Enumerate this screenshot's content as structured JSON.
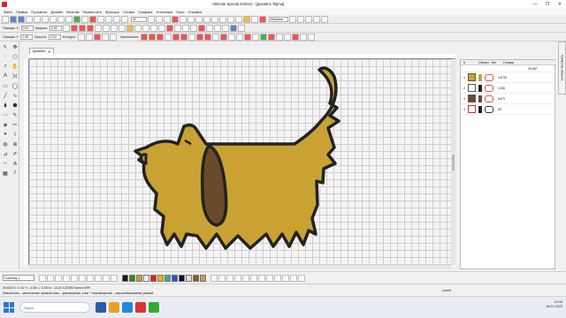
{
  "window": {
    "title": "Ultimate Special Edition) - [Дизайн1     Tajima]",
    "controls": [
      "—",
      "❐",
      "✕"
    ]
  },
  "menu": [
    "Файл",
    "Правка",
    "Просмотр",
    "Дизайн",
    "Монтаж",
    "Разместить",
    "Функции",
    "Стежки",
    "Графика",
    "Установки",
    "Окно",
    "Справка"
  ],
  "toolbar": {
    "zoom_value": "32",
    "metric": "Метрика"
  },
  "props": {
    "pos_x_label": "Позиция X:",
    "pos_x_value": "0.00",
    "pos_y_label": "Позиция Y:",
    "pos_y_value": "0.00",
    "width_label": "Ширина:",
    "width_value": "0.00",
    "height_label": "Высота:",
    "height_value": "0.00",
    "outline_label": "Контуры:",
    "fill_label": "Заполнение:"
  },
  "document": {
    "tab_label": "Дизайн1",
    "tab_close": "✕"
  },
  "objects_panel": {
    "headers": [
      "#",
      "",
      "Объект",
      "Тип",
      "Стежки"
    ],
    "top_count": "20.687",
    "rows": [
      {
        "num": "1",
        "count": "12743"
      },
      {
        "num": "2",
        "count": "1338"
      },
      {
        "num": "3",
        "count": "6473"
      },
      {
        "num": "4",
        "count": "83"
      }
    ]
  },
  "side_tab": "Свойства объекта",
  "bottom": {
    "color_select": "Colorway 1"
  },
  "palette": [
    "#1a1a1a",
    "#2a8a2a",
    "#c8a232",
    "#ffffff",
    "#d22",
    "#f4b400",
    "#4a8",
    "#2a4fd6",
    "#111",
    "#e3e3e3",
    "#8b5a2b",
    "#c96"
  ],
  "status": {
    "line1": "20.528           X= 0.44 Y= -0.08 L= 0.00 A= -13.20           CATEM Kamm 60%",
    "line2": "Левый клик – увеличение, правый клик – уменьшение; клик + перемещение – масштабирование рамкой",
    "right": "Level1"
  },
  "taskbar": {
    "search_placeholder": "Поиск",
    "time": "12:30",
    "date": "18.01.2023",
    "lang": "РУС"
  },
  "colors": {
    "fill": "#c9a233",
    "ear": "#6b4a2a",
    "outline": "#222222",
    "grid": "#cfcfcf"
  }
}
